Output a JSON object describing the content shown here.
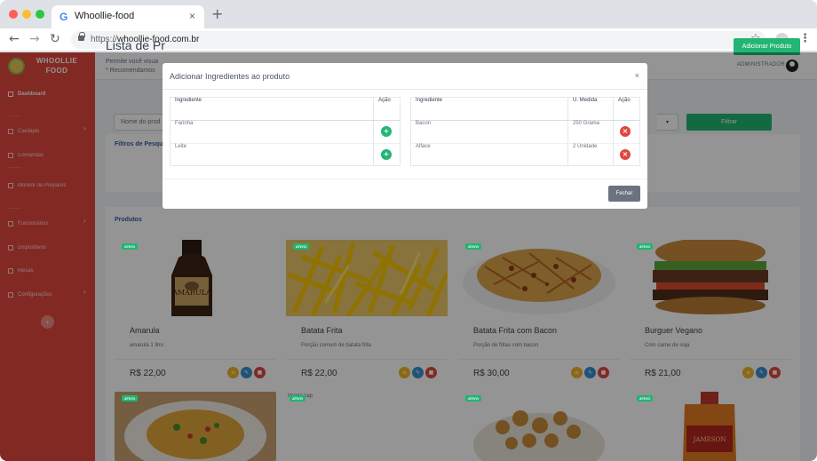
{
  "browser": {
    "tab_title": "Whoollie-food",
    "tab_favicon": "G",
    "tab_close": "×",
    "new_tab": "+",
    "url_protocol": "https://",
    "url_host": "whoollie-food.com.br",
    "icons": [
      "back-icon",
      "forward-icon",
      "reload-icon",
      "lock-icon",
      "star-icon",
      "profile-icon",
      "menu-icon"
    ]
  },
  "sidebar": {
    "brand_line1": "WHOOLLIE",
    "brand_line2": "FOOD",
    "items": [
      {
        "label": "Dashboard"
      },
      {
        "label": "Cardápio"
      },
      {
        "label": "Comandas"
      },
      {
        "label": "Monitor de Preparos"
      },
      {
        "label": "Funcionários"
      },
      {
        "label": "Dispositivos"
      },
      {
        "label": "Mesas"
      },
      {
        "label": "Configurações"
      }
    ],
    "collapse_label": "‹",
    "accent_color": "#e0473d"
  },
  "topbar": {
    "user_label": "ADMINISTRADOR"
  },
  "page": {
    "title": "Lista de Pr",
    "subtitle_line1": "Permite você visua",
    "subtitle_line2": "* Recomendamos",
    "add_button": "Adicionar Produto"
  },
  "filters": {
    "title": "Filtros de Pesqu",
    "name_placeholder": "Nome do prod",
    "filter_button": "Filtrar"
  },
  "products_section": {
    "title": "Produtos",
    "badge_label": "ATIVO",
    "items": [
      {
        "name": "Amarula",
        "description": "amarula 1 litro",
        "price": "R$ 22,00"
      },
      {
        "name": "Batata Frita",
        "description": "Porção comum de batata frita",
        "price": "R$ 22,00"
      },
      {
        "name": "Batata Frita com Bacon",
        "description": "Porção de fritas com bacon",
        "price": "R$ 30,00"
      },
      {
        "name": "Burguer Vegano",
        "description": "Com carne de soja",
        "price": "R$ 21,00"
      }
    ],
    "broken_image_alt": "Image cap"
  },
  "modal": {
    "title": "Adicionar Ingredientes ao produto",
    "close_label": "×",
    "available_table": {
      "headers": [
        "Ingrediente",
        "Ação"
      ],
      "rows": [
        {
          "ingrediente": "Farinha"
        },
        {
          "ingrediente": "Leite"
        }
      ]
    },
    "selected_table": {
      "headers": [
        "Ingrediente",
        "U. Medida",
        "Ação"
      ],
      "rows": [
        {
          "ingrediente": "Bacon",
          "medida": "250 Grama"
        },
        {
          "ingrediente": "Alface",
          "medida": "2 Unidade"
        }
      ]
    },
    "footer_button": "Fechar"
  },
  "colors": {
    "primary_green": "#22b573",
    "danger_red": "#e0473d",
    "link_blue": "#3b5ba5"
  }
}
